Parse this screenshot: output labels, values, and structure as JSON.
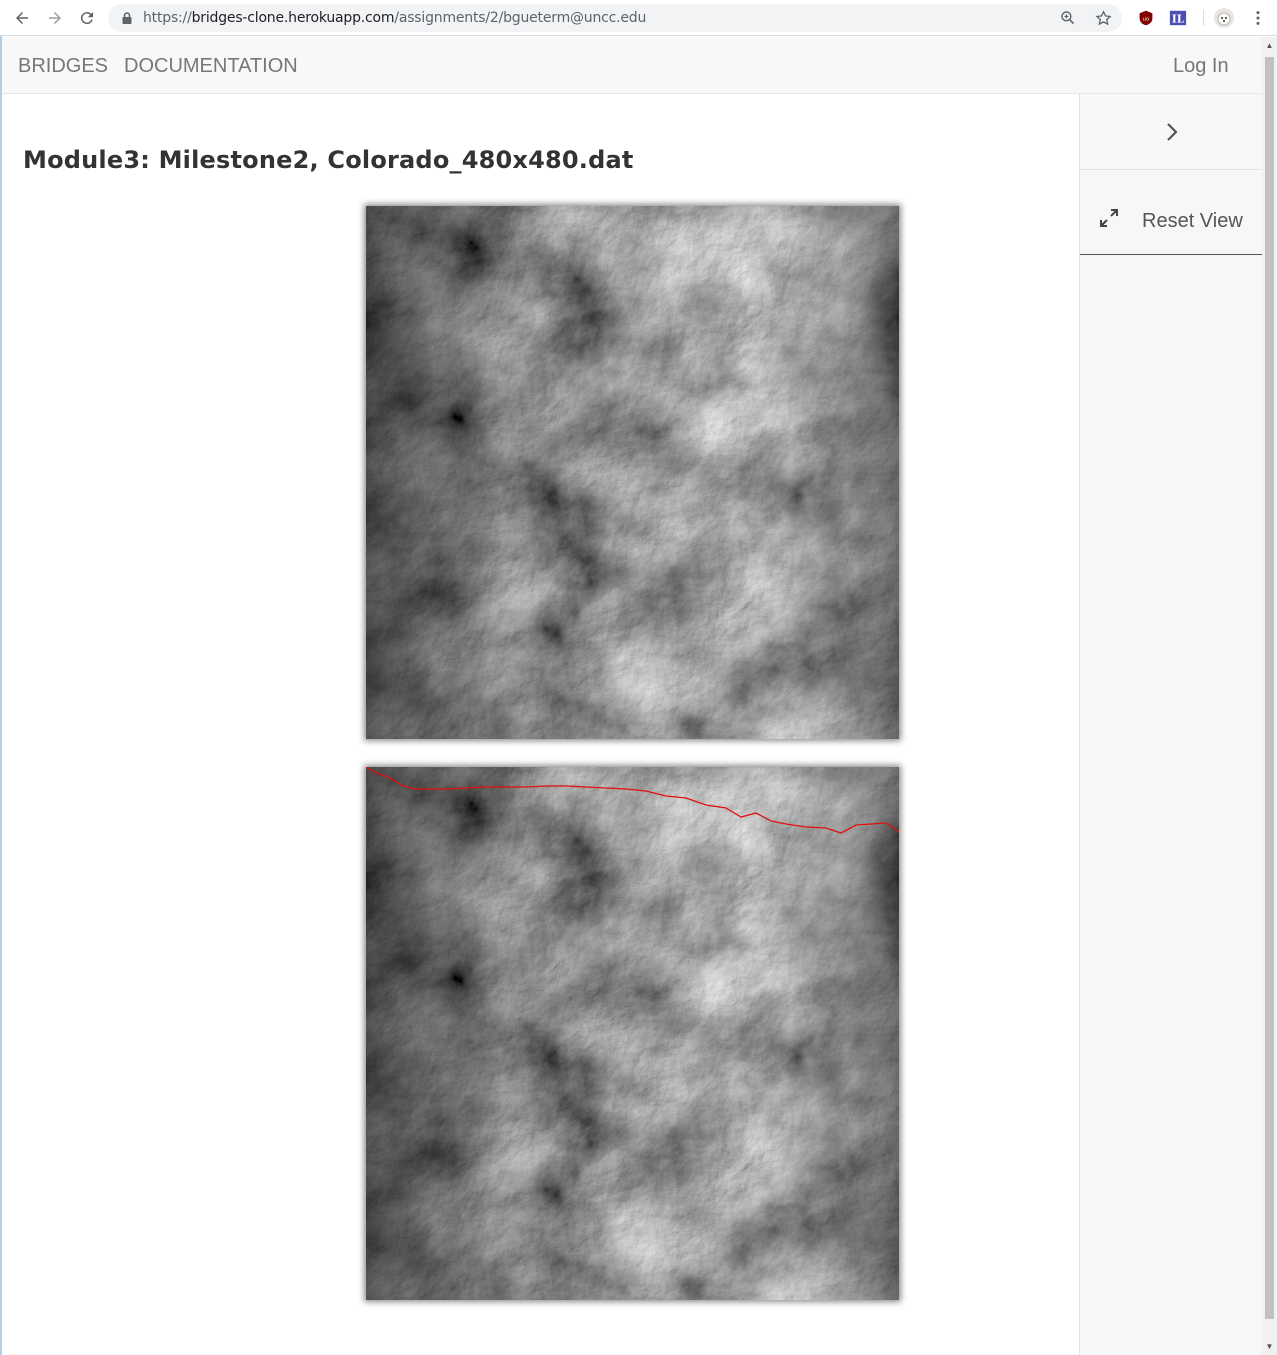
{
  "browser": {
    "url_scheme": "https://",
    "url_host": "bridges-clone.herokuapp.com",
    "url_path": "/assignments/2/bgueterm@uncc.edu",
    "icons": [
      "back-icon",
      "forward-icon",
      "reload-icon",
      "lock-icon",
      "zoom-icon",
      "bookmark-star-icon",
      "ublock-icon",
      "extension-icon",
      "profile-avatar-icon",
      "menu-kebab-icon"
    ]
  },
  "navbar": {
    "brand": "BRIDGES",
    "documentation": "DOCUMENTATION",
    "login": "Log In"
  },
  "main": {
    "title": "Module3: Milestone2, Colorado_480x480.dat",
    "images": [
      {
        "label": "elevation-map",
        "has_path": false
      },
      {
        "label": "elevation-map-with-path",
        "has_path": true,
        "path_color": "#e01010"
      }
    ]
  },
  "sidebar": {
    "toggle_icon": "chevron-right-icon",
    "reset_label": "Reset View",
    "reset_icon": "expand-arrows-icon"
  },
  "colors": {
    "navbar_bg": "#f8f8f8",
    "nav_text": "#777777",
    "path_red": "#e01010"
  }
}
